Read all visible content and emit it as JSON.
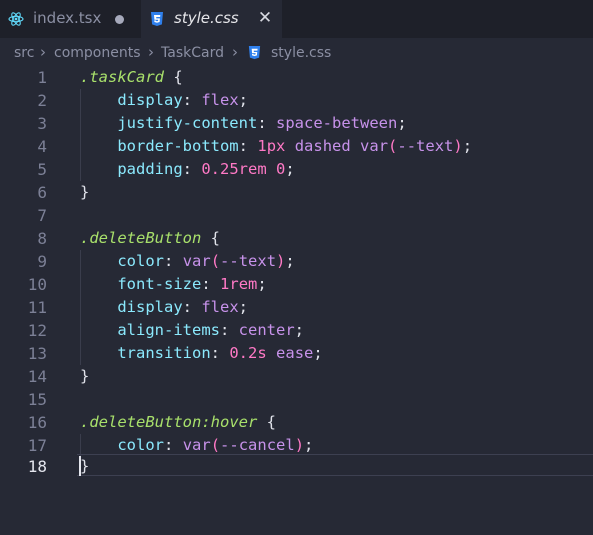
{
  "tabs": [
    {
      "label": "index.tsx",
      "icon": "react-icon",
      "modified": true,
      "active": false
    },
    {
      "label": "style.css",
      "icon": "css3-icon",
      "active": true,
      "close": "✕"
    }
  ],
  "breadcrumb": {
    "items": [
      "src",
      "components",
      "TaskCard",
      "style.css"
    ],
    "separator": "›"
  },
  "editor": {
    "line_numbers": [
      "1",
      "2",
      "3",
      "4",
      "5",
      "6",
      "7",
      "8",
      "9",
      "10",
      "11",
      "12",
      "13",
      "14",
      "15",
      "16",
      "17",
      "18"
    ],
    "active_line": "18",
    "lines": [
      ".taskCard {",
      "    display: flex;",
      "    justify-content: space-between;",
      "    border-bottom: 1px dashed var(--text);",
      "    padding: 0.25rem 0;",
      "}",
      "",
      ".deleteButton {",
      "    color: var(--text);",
      "    font-size: 1rem;",
      "    display: flex;",
      "    align-items: center;",
      "    transition: 0.2s ease;",
      "}",
      "",
      ".deleteButton:hover {",
      "    color: var(--cancel);",
      "}"
    ]
  },
  "colors": {
    "background": "#262935",
    "selector": "#a8e06b",
    "property": "#8be9fd",
    "value": "#c792ea",
    "number": "#ff79c6"
  }
}
